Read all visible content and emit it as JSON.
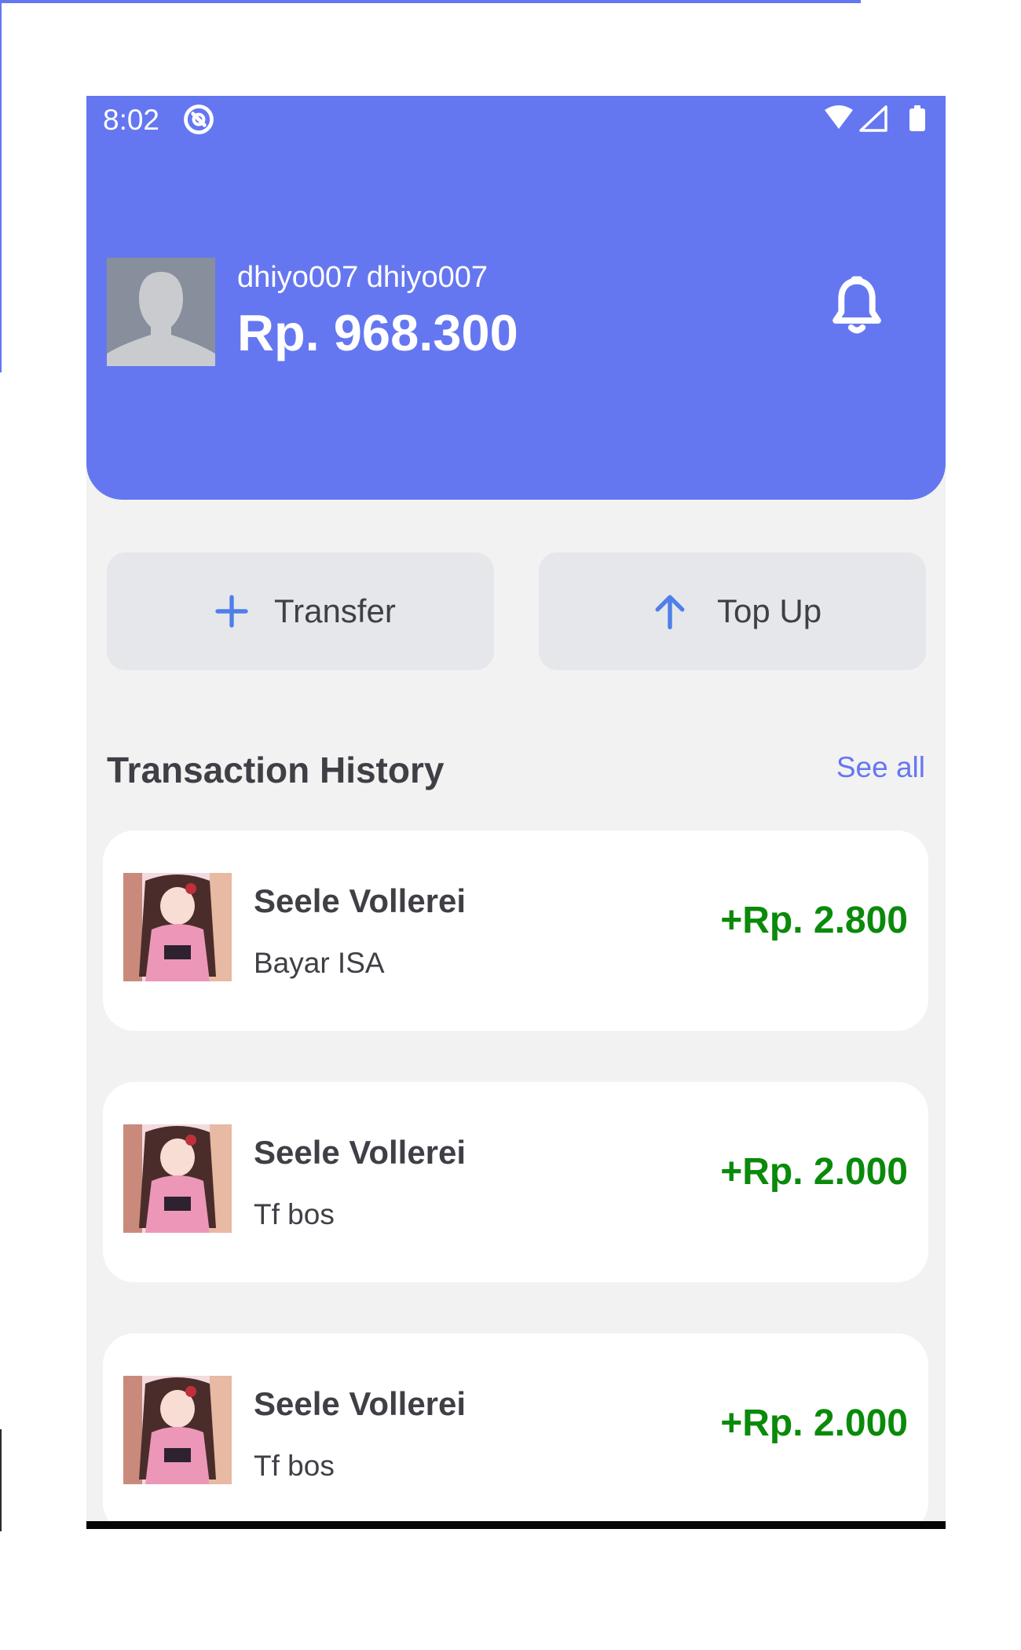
{
  "status_bar": {
    "time": "8:02"
  },
  "profile": {
    "username": "dhiyo007 dhiyo007",
    "balance": "Rp. 968.300"
  },
  "actions": {
    "transfer_label": "Transfer",
    "topup_label": "Top Up"
  },
  "history": {
    "title": "Transaction History",
    "see_all": "See all",
    "items": [
      {
        "name": "Seele Vollerei",
        "note": "Bayar ISA",
        "amount": "+Rp. 2.800"
      },
      {
        "name": "Seele Vollerei",
        "note": "Tf bos",
        "amount": "+Rp. 2.000"
      },
      {
        "name": "Seele Vollerei",
        "note": "Tf bos",
        "amount": "+Rp. 2.000"
      }
    ]
  },
  "colors": {
    "accent": "#6577f0",
    "positive_amount": "#0a8a0a",
    "button_bg": "#e5e7eb",
    "screen_bg": "#f2f2f2"
  },
  "icons": {
    "status_sync": "sync-icon",
    "wifi": "wifi-icon",
    "cell": "cell-signal-icon",
    "battery": "battery-icon",
    "notification": "bell-icon",
    "transfer": "plus-icon",
    "topup": "arrow-up-icon"
  }
}
